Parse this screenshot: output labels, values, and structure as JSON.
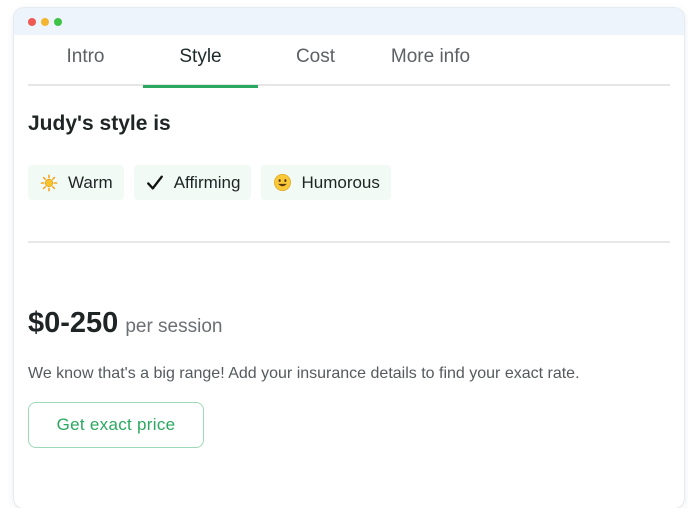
{
  "tabs": [
    {
      "label": "Intro",
      "active": false
    },
    {
      "label": "Style",
      "active": true
    },
    {
      "label": "Cost",
      "active": false
    },
    {
      "label": "More info",
      "active": false
    }
  ],
  "style_section": {
    "heading": "Judy's style is",
    "tags": [
      {
        "label": "Warm",
        "icon": "sun-icon"
      },
      {
        "label": "Affirming",
        "icon": "checkmark-icon"
      },
      {
        "label": "Humorous",
        "icon": "smiley-icon"
      }
    ]
  },
  "cost_section": {
    "price": "$0-250",
    "unit": "per session",
    "note": "We know that's a big range! Add your insurance details to find your exact rate.",
    "cta_label": "Get exact price"
  },
  "colors": {
    "accent": "#2aa860",
    "tag_background": "#f2faf5",
    "titlebar": "#eef4fb"
  }
}
